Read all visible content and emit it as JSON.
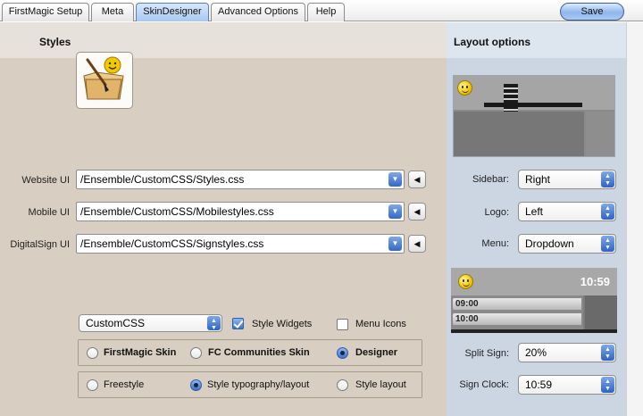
{
  "tabs": [
    {
      "label": "FirstMagic Setup",
      "active": false
    },
    {
      "label": "Meta",
      "active": false
    },
    {
      "label": "SkinDesigner",
      "active": true
    },
    {
      "label": "Advanced Options",
      "active": false
    },
    {
      "label": "Help",
      "active": false
    }
  ],
  "save_label": "Save",
  "styles": {
    "title": "Styles",
    "rows": [
      {
        "label": "Website UI",
        "value": "/Ensemble/CustomCSS/Styles.css"
      },
      {
        "label": "Mobile UI",
        "value": "/Ensemble/CustomCSS/Mobilestyles.css"
      },
      {
        "label": "DigitalSign UI",
        "value": "/Ensemble/CustomCSS/Signstyles.css"
      }
    ],
    "skin_select": "CustomCSS",
    "style_widgets": {
      "label": "Style Widgets",
      "checked": true
    },
    "menu_icons": {
      "label": "Menu Icons",
      "checked": false
    },
    "skin_options": [
      {
        "label": "FirstMagic Skin",
        "selected": false
      },
      {
        "label": "FC Communities Skin",
        "selected": false
      },
      {
        "label": "Designer",
        "selected": true
      }
    ],
    "mode_options": [
      {
        "label": "Freestyle",
        "selected": false
      },
      {
        "label": "Style typography/layout",
        "selected": true
      },
      {
        "label": "Style layout",
        "selected": false
      }
    ]
  },
  "layout": {
    "title": "Layout options",
    "sidebar": {
      "label": "Sidebar:",
      "value": "Right"
    },
    "logo": {
      "label": "Logo:",
      "value": "Left"
    },
    "menu": {
      "label": "Menu:",
      "value": "Dropdown"
    },
    "split_sign": {
      "label": "Split Sign:",
      "value": "20%"
    },
    "sign_clock": {
      "label": "Sign Clock:",
      "value": "10:59"
    },
    "preview_clock": "10:59",
    "preview_times": [
      "09:00",
      "10:00"
    ]
  },
  "colors": {
    "left_bg": "#d8cfc2",
    "right_bg": "#cbd6e2",
    "accent": "#3467c8"
  }
}
